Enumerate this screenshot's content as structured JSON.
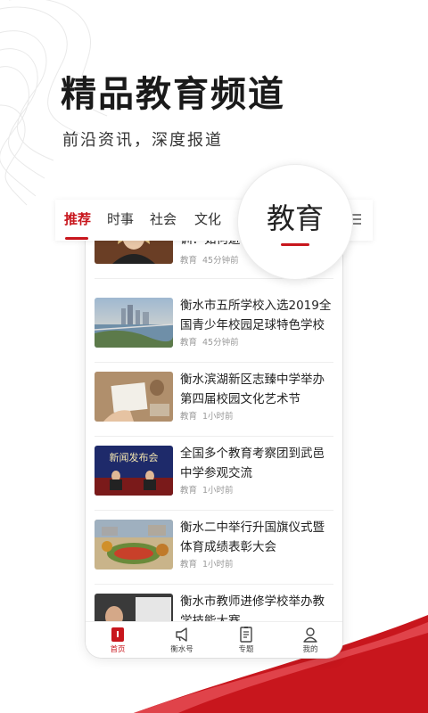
{
  "hero": {
    "title": "精品教育频道",
    "subtitle": "前沿资讯，深度报道"
  },
  "tabs": [
    {
      "label": "推荐",
      "active": true
    },
    {
      "label": "时事",
      "active": false
    },
    {
      "label": "社会",
      "active": false
    },
    {
      "label": "文化",
      "active": false
    }
  ],
  "zoom_tab": {
    "label": "教育"
  },
  "news": [
    {
      "title": "训：如何避",
      "category": "教育",
      "time": "45分钟前"
    },
    {
      "title": "衡水市五所学校入选2019全国青少年校园足球特色学校",
      "category": "教育",
      "time": "45分钟前"
    },
    {
      "title": "衡水滨湖新区志臻中学举办第四届校园文化艺术节",
      "category": "教育",
      "time": "1小时前"
    },
    {
      "title": "全国多个教育考察团到武邑中学参观交流",
      "category": "教育",
      "time": "1小时前",
      "thumb_text": "新闻发布会"
    },
    {
      "title": "衡水二中举行升国旗仪式暨体育成绩表彰大会",
      "category": "教育",
      "time": "1小时前"
    },
    {
      "title": "衡水市教师进修学校举办教学技能大赛",
      "category": "",
      "time": ""
    }
  ],
  "bottom_nav": [
    {
      "label": "首页",
      "icon": "home-icon",
      "active": true
    },
    {
      "label": "衡水号",
      "icon": "megaphone-icon",
      "active": false
    },
    {
      "label": "专题",
      "icon": "document-icon",
      "active": false
    },
    {
      "label": "我的",
      "icon": "user-icon",
      "active": false
    }
  ],
  "colors": {
    "accent": "#c8161d",
    "text": "#222222",
    "meta": "#999999"
  }
}
